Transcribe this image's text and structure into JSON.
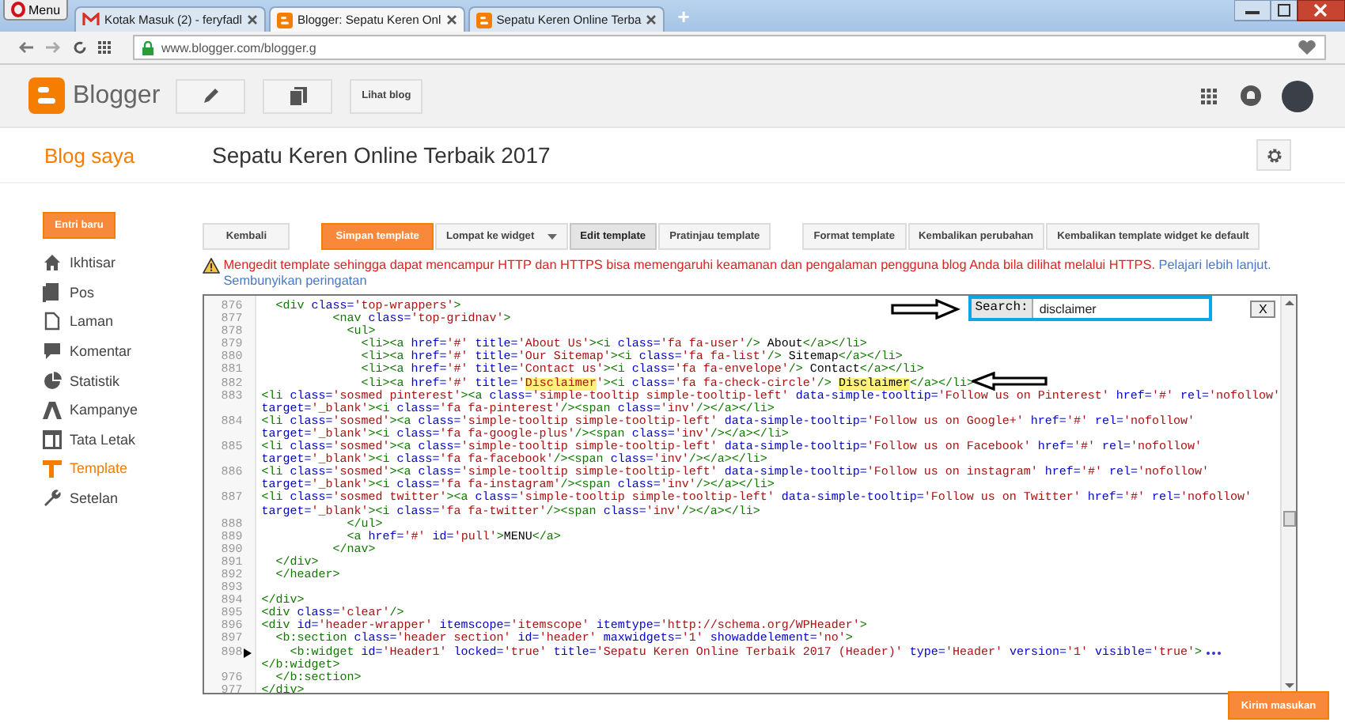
{
  "browser": {
    "menu_label": "Menu",
    "tabs": [
      {
        "title": "Kotak Masuk (2) - feryfadl",
        "selected": false
      },
      {
        "title": "Blogger: Sepatu Keren Onl",
        "selected": true
      },
      {
        "title": "Sepatu Keren Online Terba",
        "selected": false
      }
    ],
    "new_tab": "+",
    "url": "www.blogger.com/blogger.g"
  },
  "header": {
    "brand": "Blogger",
    "view_blog": "Lihat blog"
  },
  "page": {
    "section": "Blog saya",
    "blog_title": "Sepatu Keren Online Terbaik 2017"
  },
  "sidebar": {
    "new_post": "Entri baru",
    "items": [
      {
        "label": "Ikhtisar",
        "selected": false
      },
      {
        "label": "Pos",
        "selected": false
      },
      {
        "label": "Laman",
        "selected": false
      },
      {
        "label": "Komentar",
        "selected": false
      },
      {
        "label": "Statistik",
        "selected": false
      },
      {
        "label": "Kampanye",
        "selected": false
      },
      {
        "label": "Tata Letak",
        "selected": false
      },
      {
        "label": "Template",
        "selected": true
      },
      {
        "label": "Setelan",
        "selected": false
      }
    ]
  },
  "toolbar": {
    "groups": [
      [
        {
          "label": "Kembali",
          "kind": "plain",
          "selected": false
        }
      ],
      [
        {
          "label": "Simpan template",
          "kind": "primary",
          "selected": false
        },
        {
          "label": "Lompat ke widget",
          "kind": "dropdown",
          "selected": false
        },
        {
          "label": "Edit template",
          "kind": "plain",
          "selected": true
        },
        {
          "label": "Pratinjau template",
          "kind": "plain",
          "selected": false
        }
      ],
      [
        {
          "label": "Format template",
          "kind": "plain",
          "selected": false
        },
        {
          "label": "Kembalikan perubahan",
          "kind": "plain",
          "selected": false
        },
        {
          "label": "Kembalikan template widget ke default",
          "kind": "plain",
          "selected": false
        }
      ]
    ]
  },
  "warning": {
    "message": "Mengedit template sehingga dapat mencampur HTTP dan HTTPS bisa memengaruhi keamanan dan pengalaman pengguna blog Anda bila dilihat melalui HTTPS.",
    "learn_more": "Pelajari lebih lanjut.",
    "hide": "Sembunyikan peringatan"
  },
  "editor": {
    "search": {
      "label": "Search:",
      "value": "disclaimer",
      "close": "X"
    },
    "lines": [
      {
        "number": "876",
        "folded": false,
        "rows": [
          [
            {
              "text": "  <div class='top-wrappers'>",
              "highlight": false
            }
          ]
        ]
      },
      {
        "number": "877",
        "folded": false,
        "rows": [
          [
            {
              "text": "          <nav class='top-gridnav'>",
              "highlight": false
            }
          ]
        ]
      },
      {
        "number": "878",
        "folded": false,
        "rows": [
          [
            {
              "text": "            <ul>",
              "highlight": false
            }
          ]
        ]
      },
      {
        "number": "879",
        "folded": false,
        "rows": [
          [
            {
              "text": "              <li><a href='#' title='About Us'><i class='fa fa-user'/> About</a></li>",
              "highlight": false
            }
          ]
        ]
      },
      {
        "number": "880",
        "folded": false,
        "rows": [
          [
            {
              "text": "              <li><a href='#' title='Our Sitemap'><i class='fa fa-list'/> Sitemap</a></li>",
              "highlight": false
            }
          ]
        ]
      },
      {
        "number": "881",
        "folded": false,
        "rows": [
          [
            {
              "text": "              <li><a href='#' title='Contact us'><i class='fa fa-envelope'/> Contact</a></li>",
              "highlight": false
            }
          ]
        ]
      },
      {
        "number": "882",
        "folded": false,
        "rows": [
          [
            {
              "text": "              <li><a href='#' title='",
              "highlight": false
            },
            {
              "text": "Disclaimer",
              "highlight": true
            },
            {
              "text": "'><i class='fa fa-check-circle'/> ",
              "highlight": false
            },
            {
              "text": "Disclaimer",
              "highlight": true
            },
            {
              "text": "</a></li>",
              "highlight": false
            }
          ]
        ]
      },
      {
        "number": "883",
        "folded": false,
        "rows": [
          [
            {
              "text": "<li class='sosmed pinterest'><a class='simple-tooltip simple-tooltip-left' data-simple-tooltip='Follow us on Pinterest' href='#' rel='nofollow'",
              "highlight": false
            }
          ],
          [
            {
              "text": "target='_blank'><i class='fa fa-pinterest'/><span class='inv'/></a></li>",
              "highlight": false
            }
          ]
        ]
      },
      {
        "number": "884",
        "folded": false,
        "rows": [
          [
            {
              "text": "<li class='sosmed'><a class='simple-tooltip simple-tooltip-left' data-simple-tooltip='Follow us on Google+' href='#' rel='nofollow'",
              "highlight": false
            }
          ],
          [
            {
              "text": "target='_blank'><i class='fa fa-google-plus'/><span class='inv'/></a></li>",
              "highlight": false
            }
          ]
        ]
      },
      {
        "number": "885",
        "folded": false,
        "rows": [
          [
            {
              "text": "<li class='sosmed'><a class='simple-tooltip simple-tooltip-left' data-simple-tooltip='Follow us on Facebook' href='#' rel='nofollow'",
              "highlight": false
            }
          ],
          [
            {
              "text": "target='_blank'><i class='fa fa-facebook'/><span class='inv'/></a></li>",
              "highlight": false
            }
          ]
        ]
      },
      {
        "number": "886",
        "folded": false,
        "rows": [
          [
            {
              "text": "<li class='sosmed'><a class='simple-tooltip simple-tooltip-left' data-simple-tooltip='Follow us on instagram' href='#' rel='nofollow'",
              "highlight": false
            }
          ],
          [
            {
              "text": "target='_blank'><i class='fa fa-instagram'/><span class='inv'/></a></li>",
              "highlight": false
            }
          ]
        ]
      },
      {
        "number": "887",
        "folded": false,
        "rows": [
          [
            {
              "text": "<li class='sosmed twitter'><a class='simple-tooltip simple-tooltip-left' data-simple-tooltip='Follow us on Twitter' href='#' rel='nofollow'",
              "highlight": false
            }
          ],
          [
            {
              "text": "target='_blank'><i class='fa fa-twitter'/><span class='inv'/></a></li>",
              "highlight": false
            }
          ]
        ]
      },
      {
        "number": "888",
        "folded": false,
        "rows": [
          [
            {
              "text": "            </ul>",
              "highlight": false
            }
          ]
        ]
      },
      {
        "number": "889",
        "folded": false,
        "rows": [
          [
            {
              "text": "            <a href='#' id='pull'>MENU</a>",
              "highlight": false
            }
          ]
        ]
      },
      {
        "number": "890",
        "folded": false,
        "rows": [
          [
            {
              "text": "          </nav>",
              "highlight": false
            }
          ]
        ]
      },
      {
        "number": "891",
        "folded": false,
        "rows": [
          [
            {
              "text": "  </div>",
              "highlight": false
            }
          ]
        ]
      },
      {
        "number": "892",
        "folded": false,
        "rows": [
          [
            {
              "text": "  </header>",
              "highlight": false
            }
          ]
        ]
      },
      {
        "number": "893",
        "folded": false,
        "rows": [
          []
        ]
      },
      {
        "number": "894",
        "folded": false,
        "rows": [
          [
            {
              "text": "</div>",
              "highlight": false
            }
          ]
        ]
      },
      {
        "number": "895",
        "folded": false,
        "rows": [
          [
            {
              "text": "<div class='clear'/>",
              "highlight": false
            }
          ]
        ]
      },
      {
        "number": "896",
        "folded": false,
        "rows": [
          [
            {
              "text": "<div id='header-wrapper' itemscope='itemscope' itemtype='http://schema.org/WPHeader'>",
              "highlight": false
            }
          ]
        ]
      },
      {
        "number": "897",
        "folded": false,
        "rows": [
          [
            {
              "text": "  <b:section class='header section' id='header' maxwidgets='1' showaddelement='no'>",
              "highlight": false
            }
          ]
        ]
      },
      {
        "number": "898",
        "folded": true,
        "rows": [
          [
            {
              "text": "    <b:widget id='Header1' locked='true' title='Sepatu Keren Online Terbaik 2017 (Header)' type='Header' version='1' visible='true'>",
              "highlight": false
            }
          ],
          [
            {
              "text": "</b:widget>",
              "highlight": false
            }
          ]
        ]
      },
      {
        "number": "976",
        "folded": false,
        "rows": [
          [
            {
              "text": "  </b:section>",
              "highlight": false
            }
          ]
        ]
      },
      {
        "number": "977",
        "folded": false,
        "rows": [
          [
            {
              "text": "</div>",
              "highlight": false
            }
          ]
        ]
      }
    ]
  },
  "feedback": "Kirim masukan"
}
